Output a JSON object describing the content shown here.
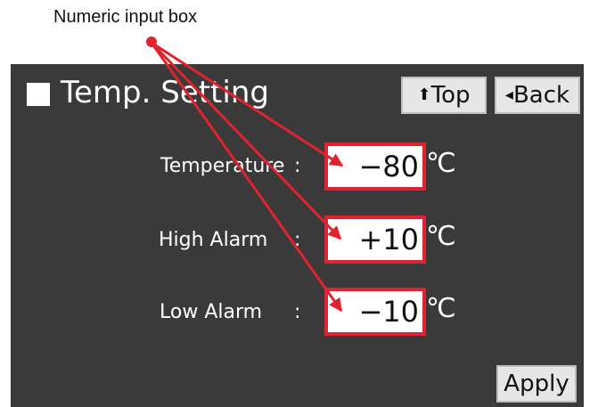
{
  "callout": {
    "text": "Numeric input box"
  },
  "screen": {
    "title": "Temp. Setting",
    "top_button": {
      "glyph": "⬆",
      "label": "Top"
    },
    "back_button": {
      "glyph": "◂",
      "label": "Back"
    },
    "apply_button": "Apply",
    "fields": [
      {
        "label": "Temperature",
        "colon": ":",
        "value": "−80",
        "unit": "℃"
      },
      {
        "label": "High Alarm",
        "colon": ":",
        "value": "+10",
        "unit": "℃"
      },
      {
        "label": "Low Alarm",
        "colon": ":",
        "value": "−10",
        "unit": "℃"
      }
    ]
  },
  "colors": {
    "panel": "#3a3a3a",
    "highlight": "#e0232e",
    "button": "#e6e6e6"
  }
}
